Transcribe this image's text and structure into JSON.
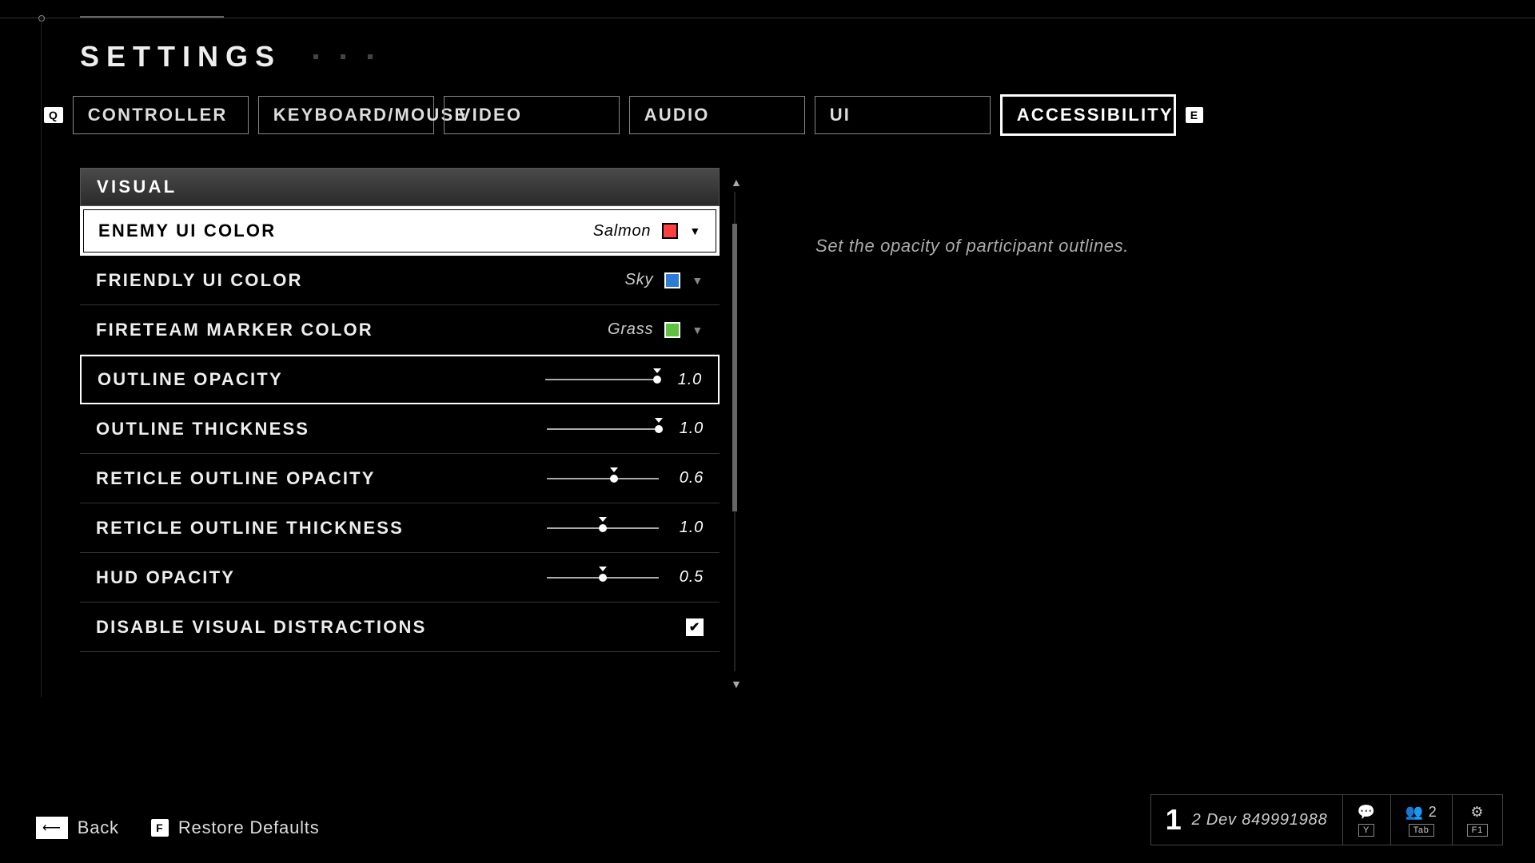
{
  "header": {
    "title": "SETTINGS"
  },
  "nav_keys": {
    "left": "Q",
    "right": "E"
  },
  "tabs": [
    {
      "label": "CONTROLLER"
    },
    {
      "label": "KEYBOARD/MOUSE"
    },
    {
      "label": "VIDEO"
    },
    {
      "label": "AUDIO"
    },
    {
      "label": "UI"
    },
    {
      "label": "ACCESSIBILITY"
    }
  ],
  "section": {
    "title": "VISUAL"
  },
  "rows": {
    "enemy": {
      "label": "ENEMY UI COLOR",
      "value": "Salmon",
      "swatch": "#ff4040"
    },
    "friendly": {
      "label": "FRIENDLY UI COLOR",
      "value": "Sky",
      "swatch": "#2e7bd6"
    },
    "fireteam": {
      "label": "FIRETEAM MARKER COLOR",
      "value": "Grass",
      "swatch": "#5fbf3f"
    },
    "outline_opacity": {
      "label": "OUTLINE OPACITY",
      "value": "1.0",
      "pct": 100
    },
    "outline_thickness": {
      "label": "OUTLINE THICKNESS",
      "value": "1.0",
      "pct": 100
    },
    "ret_opacity": {
      "label": "RETICLE OUTLINE OPACITY",
      "value": "0.6",
      "pct": 60
    },
    "ret_thickness": {
      "label": "RETICLE OUTLINE THICKNESS",
      "value": "1.0",
      "pct": 50
    },
    "hud_opacity": {
      "label": "HUD OPACITY",
      "value": "0.5",
      "pct": 50
    },
    "disable_vd": {
      "label": "DISABLE VISUAL DISTRACTIONS",
      "checked": true
    }
  },
  "description": "Set the opacity of participant outlines.",
  "footer": {
    "back": {
      "key": "←",
      "label": "Back"
    },
    "restore": {
      "key": "F",
      "label": "Restore Defaults"
    }
  },
  "status": {
    "rank": "1",
    "build": "2 Dev 849991988",
    "players": "2",
    "keys": {
      "chat": "Y",
      "scoreboard": "Tab",
      "help": "F1"
    }
  }
}
